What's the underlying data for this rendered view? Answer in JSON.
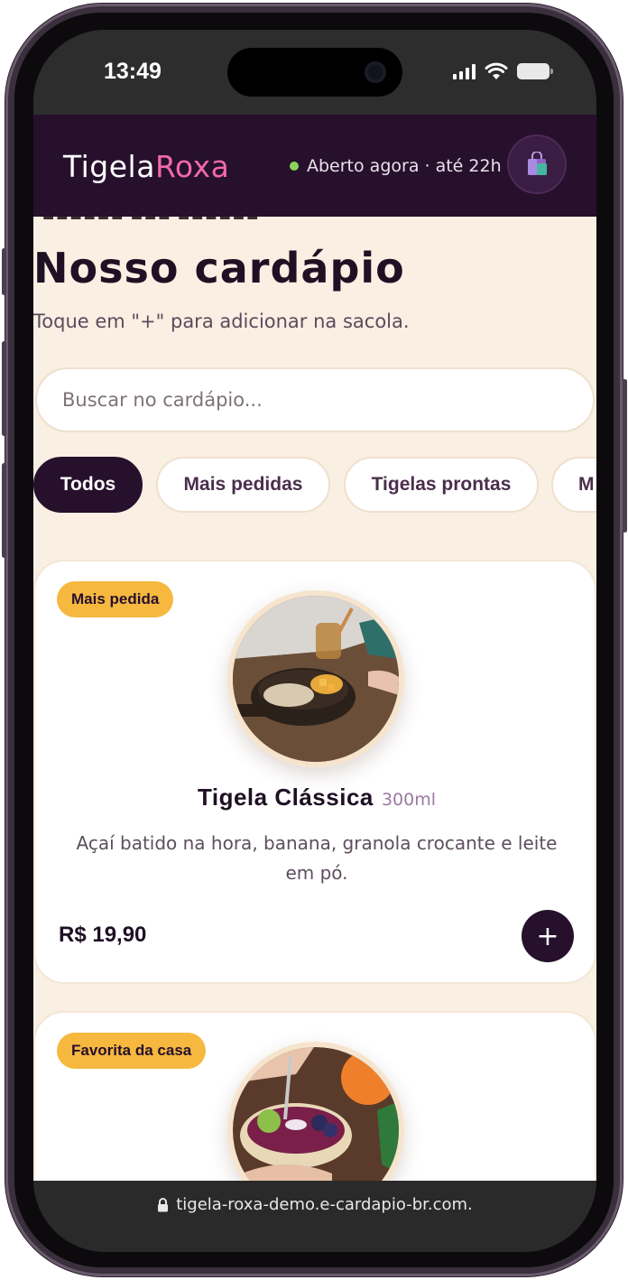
{
  "status_bar": {
    "time": "13:49"
  },
  "header": {
    "brand_part1": "Tigela",
    "brand_part2": "Roxa",
    "open_status": "Aberto agora · até 22h",
    "bag_icon": "shopping-bag-icon"
  },
  "page": {
    "title": "Nosso cardápio",
    "subtitle": "Toque em \"+\" para adicionar na sacola."
  },
  "search": {
    "placeholder": "Buscar no cardápio..."
  },
  "categories": [
    {
      "label": "Todos",
      "active": true
    },
    {
      "label": "Mais pedidas",
      "active": false
    },
    {
      "label": "Tigelas prontas",
      "active": false
    },
    {
      "label": "M",
      "active": false
    }
  ],
  "products": [
    {
      "badge": "Mais pedida",
      "name": "Tigela Clássica",
      "size": "300ml",
      "description": "Açaí batido na hora, banana, granola crocante e leite em pó.",
      "price": "R$ 19,90",
      "add_label": "+"
    },
    {
      "badge": "Favorita da casa"
    }
  ],
  "url_bar": {
    "url": "tigela-roxa-demo.e-cardapio-br.com.",
    "lock_icon": "lock-icon"
  },
  "colors": {
    "header_bg": "#26102c",
    "brand_accent": "#f06aa6",
    "page_bg": "#f9efe3",
    "badge_bg": "#f6b83f",
    "open_dot": "#8bd45c"
  }
}
